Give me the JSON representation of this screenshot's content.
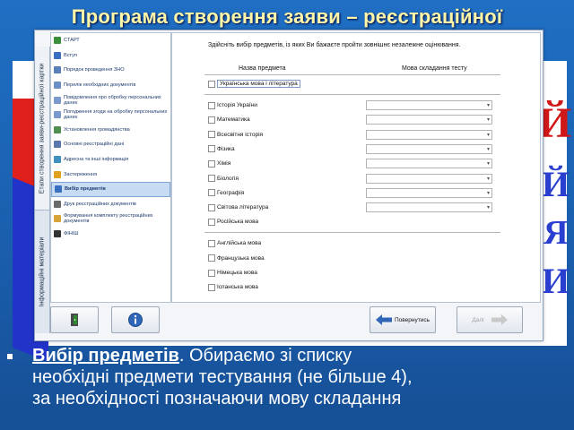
{
  "slide": {
    "title": "Програма створення заяви – реєстраційної",
    "bullet": {
      "lead": "Вибір предметів",
      "line1_rest": ". Обираємо зі списку",
      "line2": "необхідні предмети тестування (не більше 4),",
      "line3": "за необхідності позначаючи мову складання"
    },
    "deco_letters": [
      "Й",
      "Й",
      "Я",
      "И"
    ]
  },
  "window": {
    "vertical_tabs": [
      "Етапи створення заяви-реєстраційної картки",
      "Інформаційні матеріали"
    ],
    "steps": [
      {
        "label": "СТАРТ",
        "icon": "flag-icon",
        "color": "#3a8f3a"
      },
      {
        "label": "Вступ",
        "icon": "info-icon",
        "color": "#3b6fc1"
      },
      {
        "label": "Порядок проведення ЗНО",
        "icon": "book-icon",
        "color": "#5b7fb8"
      },
      {
        "label": "Перелік необхідних документів",
        "icon": "document-icon",
        "color": "#6a8fc4"
      },
      {
        "label": "Повідомлення про обробку персональних даних",
        "icon": "document-icon",
        "color": "#7a9acb"
      },
      {
        "label": "Погодження згоди на обробку персональних даних",
        "icon": "document-icon",
        "color": "#7a9acb"
      },
      {
        "label": "Установлення громадянства",
        "icon": "passport-icon",
        "color": "#4f8f4f"
      },
      {
        "label": "Основні реєстраційні дані",
        "icon": "form-icon",
        "color": "#5779ad"
      },
      {
        "label": "Адресна та інші інформація",
        "icon": "address-icon",
        "color": "#3f8fbf"
      },
      {
        "label": "Застереження",
        "icon": "warning-icon",
        "color": "#e0a020"
      },
      {
        "label": "Вибір предметів",
        "icon": "checklist-icon",
        "color": "#3b6fc1",
        "selected": true
      },
      {
        "label": "Друк реєстраційних документів",
        "icon": "printer-icon",
        "color": "#6b6b6b"
      },
      {
        "label": "Формування комплекту реєстраційних документів",
        "icon": "folder-icon",
        "color": "#d8a43a"
      },
      {
        "label": "ФІНІШ",
        "icon": "finish-flag-icon",
        "color": "#333333"
      }
    ],
    "instruction": "Здійсніть вибір предметів, із яких Ви бажаєте пройти зовнішнє незалежне оцінювання.",
    "columns": {
      "subject": "Назва предмета",
      "language": "Мова складання тесту"
    },
    "subjects_top": [
      "Українська мова і література"
    ],
    "subjects_with_language": [
      "Історія України",
      "Математика",
      "Всесвітня історія",
      "Фізика",
      "Хімія",
      "Біологія",
      "Географія",
      "Світова література"
    ],
    "subjects_plain": [
      "Російська мова"
    ],
    "subjects_foreign": [
      "Англійська мова",
      "Французька мова",
      "Німецька мова",
      "Іспанська мова"
    ],
    "language_placeholder": "",
    "buttons": {
      "back": "Повернутись",
      "next": "Далі"
    },
    "bottom_icons": {
      "exit": "exit-door-icon",
      "info": "info-icon"
    }
  }
}
